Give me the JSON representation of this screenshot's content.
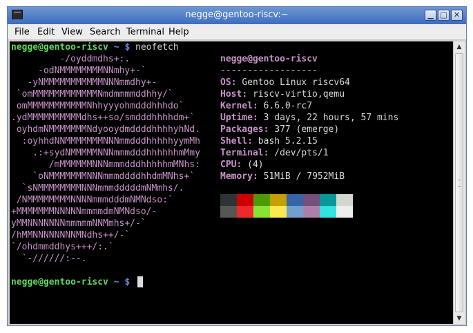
{
  "window": {
    "title": "negge@gentoo-riscv:~",
    "icons": {
      "app": "terminal-icon",
      "minimize": "minimize-icon",
      "maximize": "maximize-icon",
      "close": "close-icon"
    }
  },
  "menubar": {
    "items": [
      "File",
      "Edit",
      "View",
      "Search",
      "Terminal",
      "Help"
    ]
  },
  "terminal": {
    "prompt_user": "negge@gentoo-riscv",
    "prompt_path": "~",
    "prompt_symbol": "$",
    "command": "neofetch",
    "logo": [
      "         -/oyddmdhs+:.",
      "     -odNMMMMMMMMNNmhy+-`",
      "   -yNMMMMMMMMMMMNNNmmdhy+-",
      " `omMMMMMMMMMMMMNmdmmmmddhhy/`",
      " omMMMMMMMMMMMNhhyyyohmdddhhhdo`",
      ".ydMMMMMMMMMMdhs++so/smdddhhhhdm+`",
      " oyhdmNMMMMMMMNdyooydmddddhhhhyhNd.",
      "  :oyhhdNNMMMMMMMNNNmmdddhhhhhyymMh",
      "    .:+sydNMMMMMNNNmmmdddhhhhhhmMmy",
      "       /mMMMMMMNNNmmmdddhhhhhmMNhs:",
      "    `oNMMMMMMMNNNmmmddddhhdmMNhs+`",
      "  `sNMMMMMMMMNNNmmmdddddmNMmhs/.",
      " /NMMMMMMMMNNNNmmmdddmNMNdso:`",
      "+MMMMMMMNNNNNmmmmdmNMNdso/-",
      "yMMNNNNNNNmmmmmNNMmhs+/-`",
      "/hMMNNNNNNNNMNdhs++/-`",
      "`/ohdmmddhys+++/:.`",
      "  `-//////:--."
    ],
    "info": {
      "header": "negge@gentoo-riscv",
      "separator": "------------------",
      "rows": [
        {
          "key": "OS",
          "value": "Gentoo Linux riscv64"
        },
        {
          "key": "Host",
          "value": "riscv-virtio,qemu"
        },
        {
          "key": "Kernel",
          "value": "6.6.0-rc7"
        },
        {
          "key": "Uptime",
          "value": "3 days, 22 hours, 57 mins"
        },
        {
          "key": "Packages",
          "value": "377 (emerge)"
        },
        {
          "key": "Shell",
          "value": "bash 5.2.15"
        },
        {
          "key": "Terminal",
          "value": "/dev/pts/1"
        },
        {
          "key": "CPU",
          "value": "(4)"
        },
        {
          "key": "Memory",
          "value": "51MiB / 7952MiB"
        }
      ]
    },
    "palette": {
      "normal": [
        "#2e3436",
        "#cc0000",
        "#4e9a06",
        "#c4a000",
        "#3465a4",
        "#75507b",
        "#06989a",
        "#d3d7cf"
      ],
      "bright": [
        "#555753",
        "#ef2929",
        "#8ae234",
        "#fce94f",
        "#729fcf",
        "#ad7fa8",
        "#34e2e2",
        "#eeeeec"
      ]
    }
  }
}
